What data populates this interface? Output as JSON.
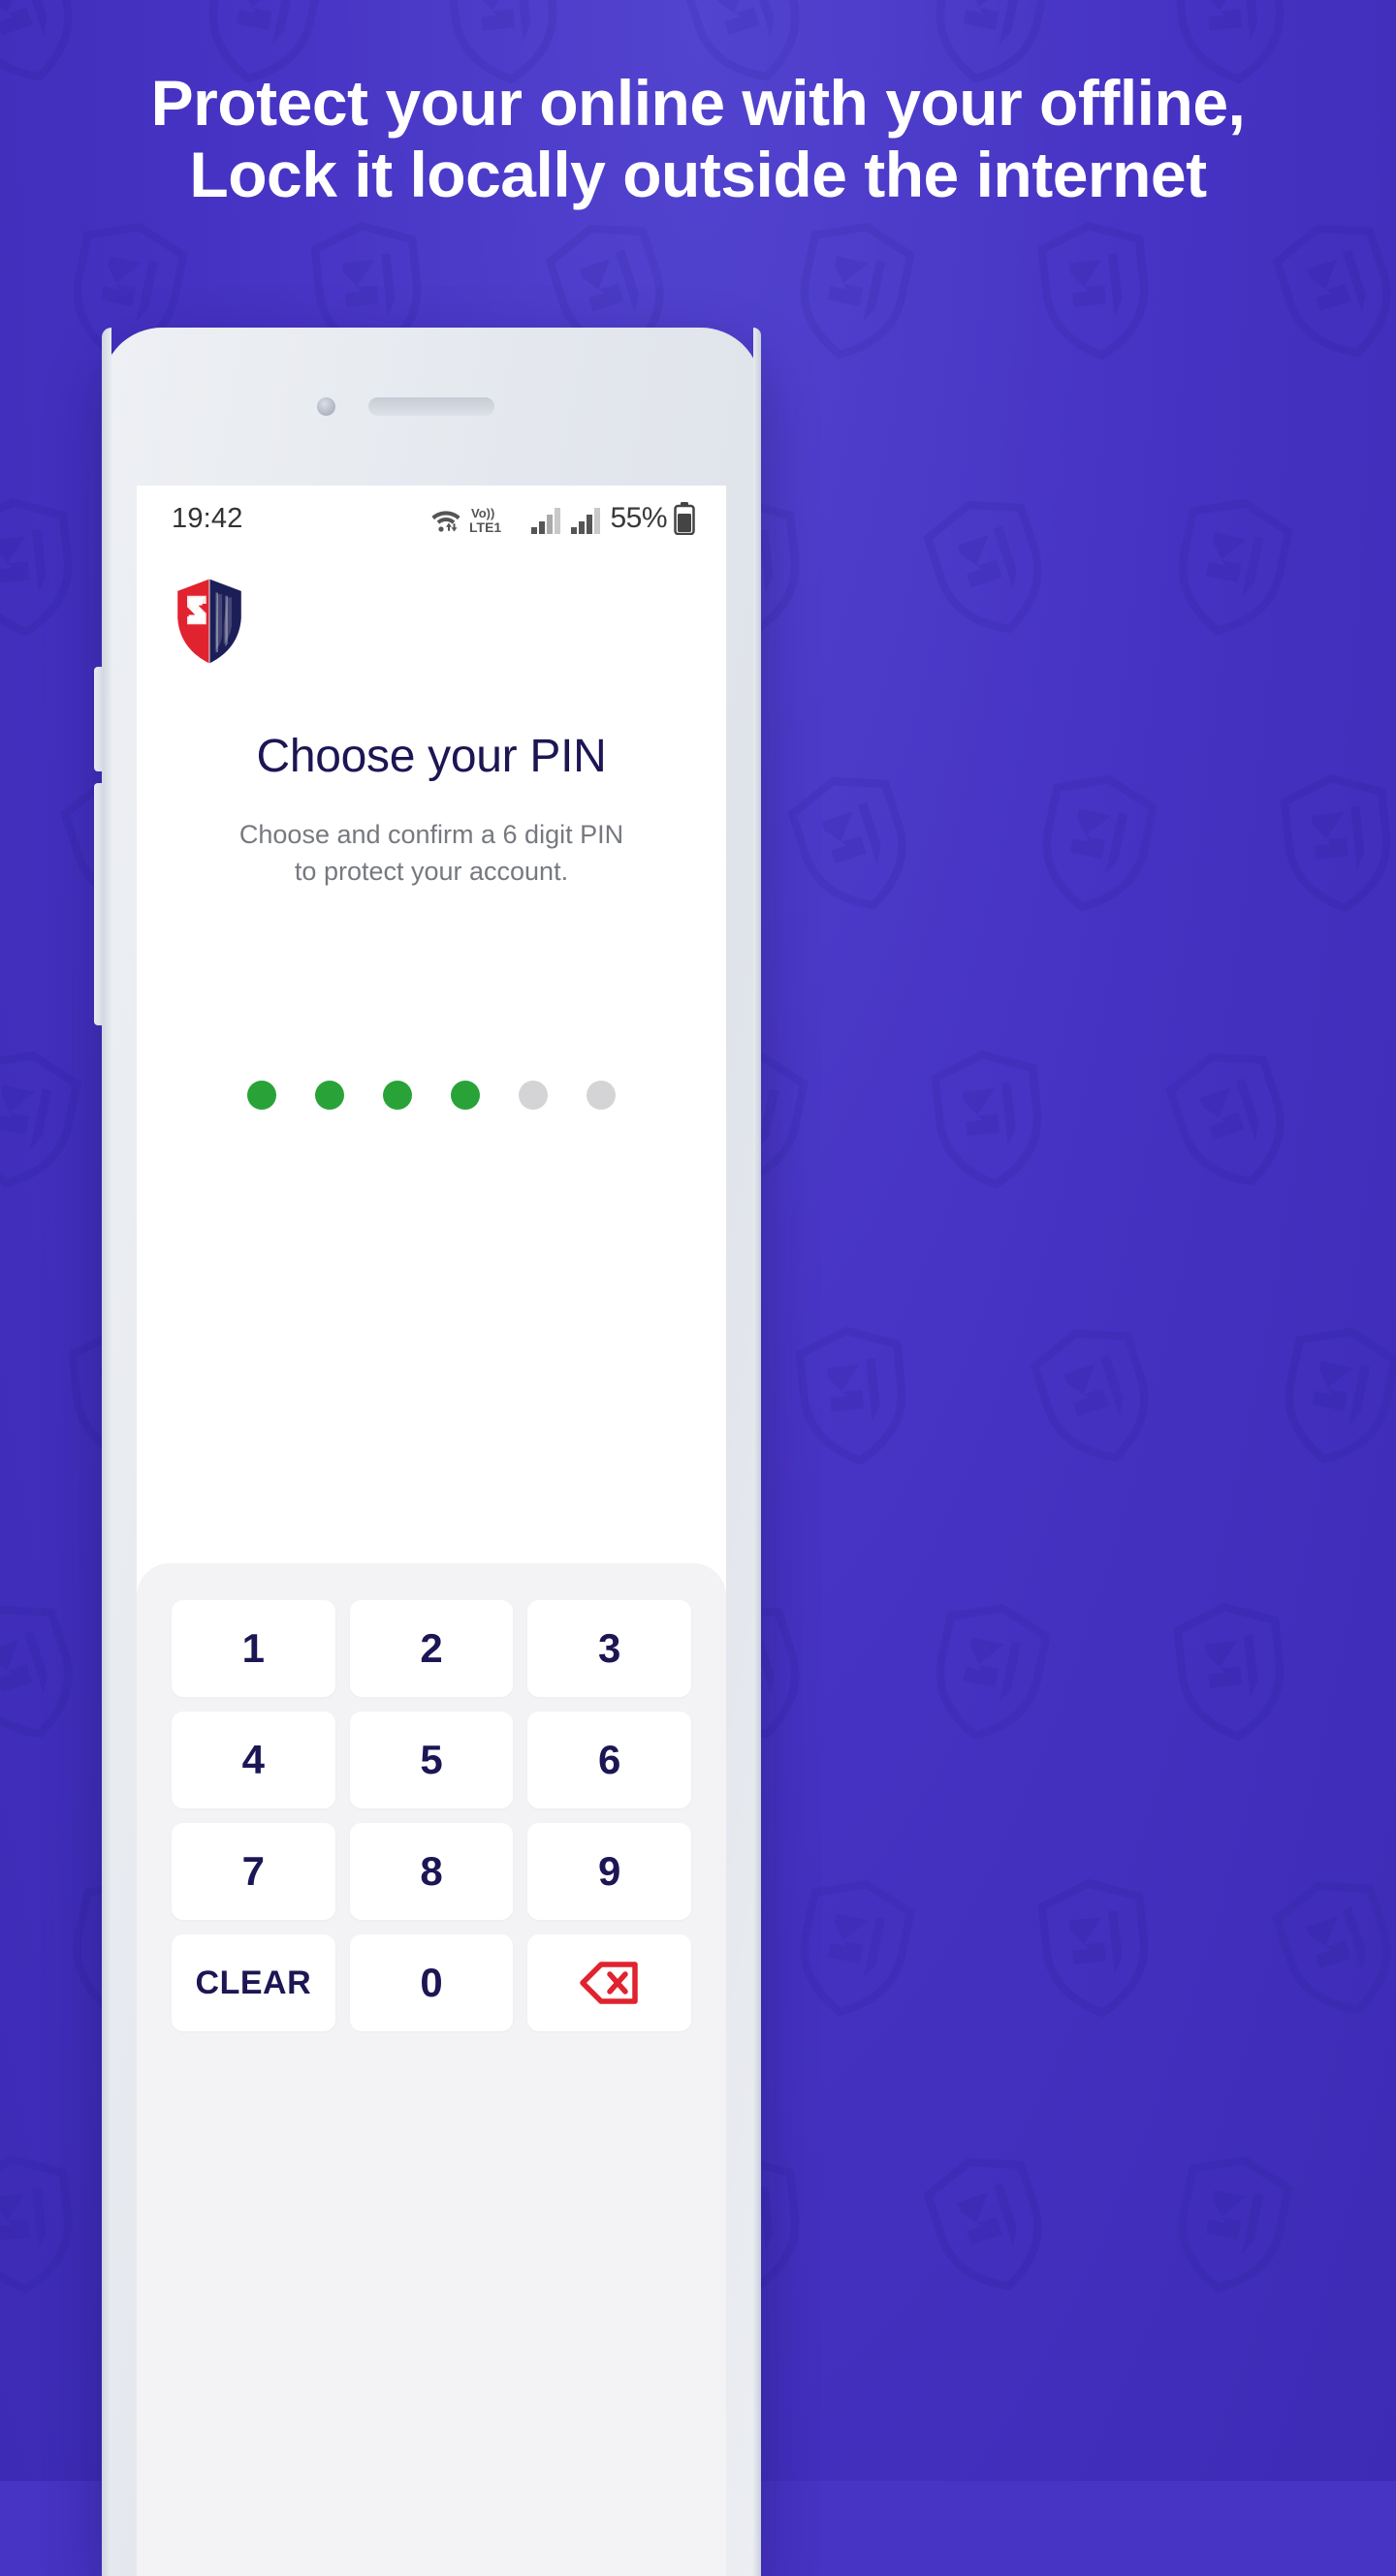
{
  "promo": {
    "headline": "Protect your online with your offline, Lock it locally outside the internet",
    "background_color": "#4733c4",
    "headline_color": "#ffffff"
  },
  "phone": {
    "hardware": {
      "earpiece_speaker": "earpiece-speaker",
      "front_camera": "front-camera",
      "side_button_volume": "volume-button",
      "side_button_power": "power-button"
    }
  },
  "status_bar": {
    "time": "19:42",
    "battery_percent": "55%",
    "icons": [
      "wifi-icon",
      "volte-lte1-icon",
      "signal-bars-sim1-icon",
      "signal-bars-sim2-icon",
      "battery-icon"
    ],
    "volte_label": "Vo))",
    "lte_label": "LTE1"
  },
  "app": {
    "logo_name": "shield-3v-logo",
    "logo_colors": {
      "red": "#e0232e",
      "navy": "#1c1f57"
    }
  },
  "screen": {
    "title": "Choose your PIN",
    "subtitle_line1": "Choose and confirm a 6 digit PIN",
    "subtitle_line2": "to protect your account.",
    "title_color": "#1c1654",
    "subtitle_color": "#76797f"
  },
  "pin": {
    "length": 6,
    "entered": 4,
    "filled_color": "#29a338",
    "empty_color": "#d4d4d6",
    "dots": [
      {
        "filled": true
      },
      {
        "filled": true
      },
      {
        "filled": true
      },
      {
        "filled": true
      },
      {
        "filled": false
      },
      {
        "filled": false
      }
    ]
  },
  "keypad": {
    "background_color": "#f3f3f5",
    "key_color": "#ffffff",
    "label_color": "#1c1654",
    "backspace_color": "#e0232e",
    "rows": [
      [
        {
          "label": "1",
          "name": "key-1"
        },
        {
          "label": "2",
          "name": "key-2"
        },
        {
          "label": "3",
          "name": "key-3"
        }
      ],
      [
        {
          "label": "4",
          "name": "key-4"
        },
        {
          "label": "5",
          "name": "key-5"
        },
        {
          "label": "6",
          "name": "key-6"
        }
      ],
      [
        {
          "label": "7",
          "name": "key-7"
        },
        {
          "label": "8",
          "name": "key-8"
        },
        {
          "label": "9",
          "name": "key-9"
        }
      ]
    ],
    "bottom_row": {
      "clear_label": "CLEAR",
      "zero_label": "0",
      "backspace_label": "backspace-icon"
    }
  }
}
